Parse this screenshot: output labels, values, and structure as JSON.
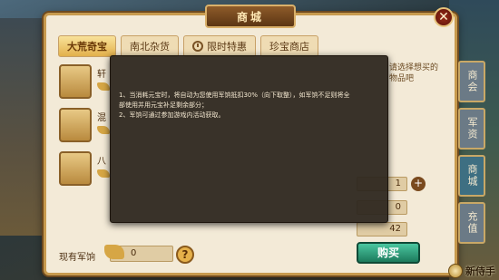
{
  "window": {
    "title": "商城",
    "close_symbol": "✕"
  },
  "tabs": [
    {
      "label": "大荒奇宝",
      "active": true
    },
    {
      "label": "南北杂货",
      "active": false
    },
    {
      "label": "限时特惠",
      "active": false,
      "icon": "clock-icon"
    },
    {
      "label": "珍宝商店",
      "active": false
    }
  ],
  "items": [
    {
      "name": "轩"
    },
    {
      "name": "混"
    },
    {
      "name": "八"
    }
  ],
  "side_tabs": [
    {
      "label": "商会",
      "active": false
    },
    {
      "label": "军资",
      "active": false
    },
    {
      "label": "商城",
      "active": true
    },
    {
      "label": "充值",
      "active": false
    }
  ],
  "detail": {
    "hint": "请选择想买的物品吧",
    "qty_value": "1",
    "cost_value": "0",
    "have_value": "42"
  },
  "bottom": {
    "own_label": "现有军饷",
    "own_value": "0",
    "help_symbol": "?",
    "buy_label": "购买"
  },
  "overlay": {
    "lines": [
      "1、当消耗元宝时，将自动为您使用军饷抵扣30%（向下取整），如军饷不足则将全",
      "部使用并用元宝补足剩余部分；",
      "2、军饷可通过参加游戏内活动获取。"
    ]
  },
  "watermark": {
    "text": "新侍手"
  }
}
